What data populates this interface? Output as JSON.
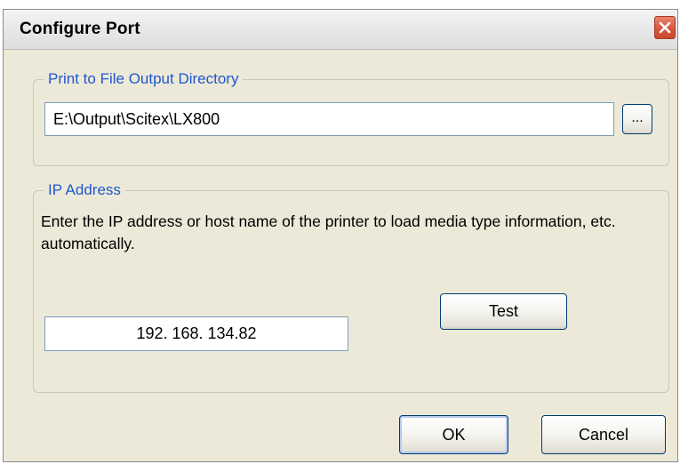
{
  "window": {
    "title": "Configure Port",
    "close_icon": "close-icon"
  },
  "output_group": {
    "legend": "Print to File Output Directory",
    "directory_value": "E:\\Output\\Scitex\\LX800",
    "browse_label": "..."
  },
  "ip_group": {
    "legend": "IP Address",
    "instructions": "Enter the IP address or host name of the printer to load media type information, etc. automatically.",
    "ip_value": "192. 168. 134.82",
    "test_label": "Test"
  },
  "buttons": {
    "ok_label": "OK",
    "cancel_label": "Cancel"
  },
  "colors": {
    "dialog_bg": "#ece9d8",
    "legend_text": "#1f57d1",
    "close_button": "#d7553b",
    "button_border": "#003c74"
  }
}
